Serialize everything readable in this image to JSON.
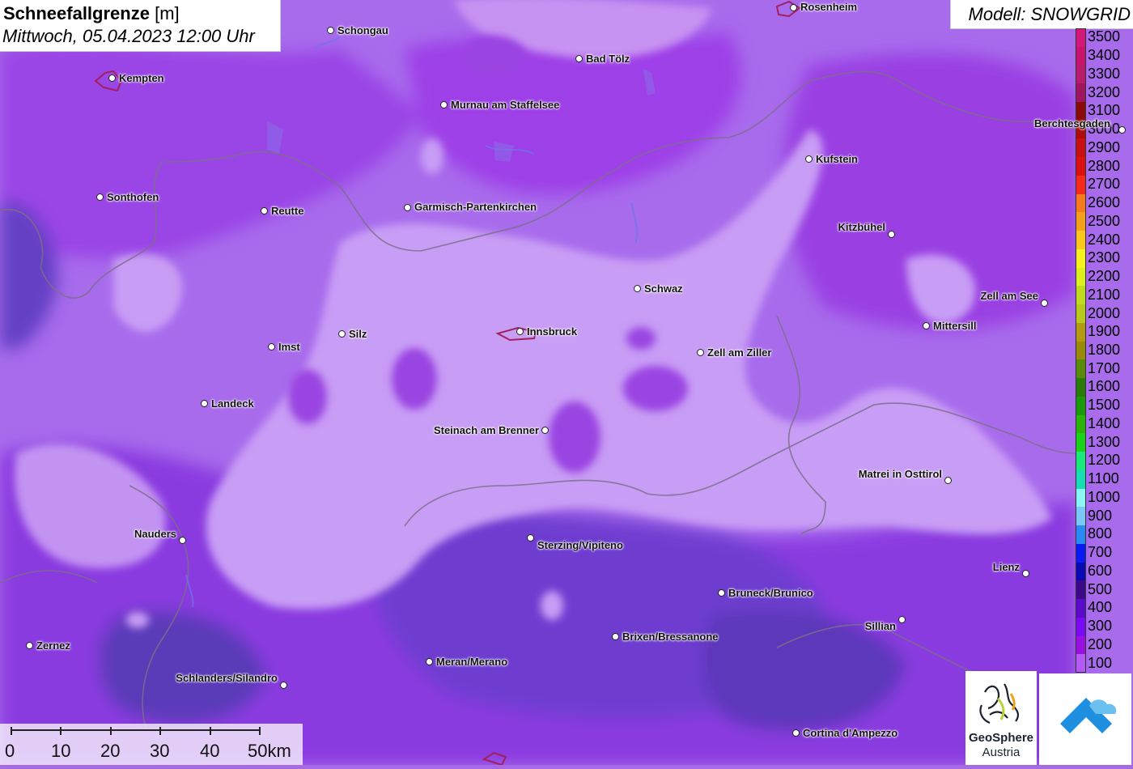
{
  "header": {
    "title": "Schneefallgrenze",
    "unit": "[m]",
    "datetime": "Mittwoch, 05.04.2023 12:00 Uhr"
  },
  "model_label": "Modell: SNOWGRID",
  "legend": {
    "labels": [
      "3500",
      "3400",
      "3300",
      "3200",
      "3100",
      "3000",
      "2900",
      "2800",
      "2700",
      "2600",
      "2500",
      "2400",
      "2300",
      "2200",
      "2100",
      "2000",
      "1900",
      "1800",
      "1700",
      "1600",
      "1500",
      "1400",
      "1300",
      "1200",
      "1100",
      "1000",
      "900",
      "800",
      "700",
      "600",
      "500",
      "400",
      "300",
      "200",
      "100"
    ],
    "colors": [
      "#d4187a",
      "#c8146c",
      "#b81a6e",
      "#a01560",
      "#8a0a0a",
      "#b00a0a",
      "#c81010",
      "#dd1010",
      "#f52a1a",
      "#f57a20",
      "#f5a01a",
      "#fac81e",
      "#f5f21e",
      "#dcf01e",
      "#c0dc1e",
      "#b8c81c",
      "#b49a12",
      "#9a8a0a",
      "#5a8a0a",
      "#2a7a0a",
      "#1a9a0a",
      "#2ab40a",
      "#1ad21a",
      "#1ae87a",
      "#1adcb4",
      "#8af5f5",
      "#7ac8f5",
      "#2a8af5",
      "#0a1af5",
      "#0a0ab4",
      "#3a0a8a",
      "#5a0ac8",
      "#7a0af5",
      "#9a10e0",
      "#b45af5"
    ]
  },
  "cities": [
    {
      "name": "Rosenheim",
      "dot": [
        980,
        9
      ],
      "label": [
        989,
        9
      ],
      "align": "left"
    },
    {
      "name": "Schongau",
      "dot": [
        408,
        37
      ],
      "label": [
        417,
        38
      ],
      "align": "left"
    },
    {
      "name": "Bad Tölz",
      "dot": [
        715,
        72
      ],
      "label": [
        724,
        73
      ],
      "align": "left"
    },
    {
      "name": "Kempten",
      "dot": [
        138,
        96
      ],
      "label": [
        147,
        97
      ],
      "align": "left"
    },
    {
      "name": "Murnau am Staffelsee",
      "dot": [
        548,
        129
      ],
      "label": [
        557,
        130
      ],
      "align": "left"
    },
    {
      "name": "Berchtesgaden",
      "dot": [
        1386,
        160
      ],
      "label": [
        1278,
        153
      ],
      "align": "left"
    },
    {
      "name": "Kufstein",
      "dot": [
        999,
        196
      ],
      "label": [
        1008,
        197
      ],
      "align": "left"
    },
    {
      "name": "Sonthofen",
      "dot": [
        123,
        243
      ],
      "label": [
        132,
        244
      ],
      "align": "left"
    },
    {
      "name": "Reutte",
      "dot": [
        326,
        260
      ],
      "label": [
        335,
        261
      ],
      "align": "left"
    },
    {
      "name": "Garmisch-Partenkirchen",
      "dot": [
        503,
        256
      ],
      "label": [
        512,
        256
      ],
      "align": "left"
    },
    {
      "name": "Kitzbühel",
      "dot": [
        1101,
        289
      ],
      "label": [
        1094,
        281
      ],
      "align": "right"
    },
    {
      "name": "Schwaz",
      "dot": [
        787,
        356
      ],
      "label": [
        796,
        357
      ],
      "align": "left"
    },
    {
      "name": "Zell am See",
      "dot": [
        1290,
        374
      ],
      "label": [
        1283,
        366
      ],
      "align": "right"
    },
    {
      "name": "Mittersill",
      "dot": [
        1144,
        402
      ],
      "label": [
        1153,
        403
      ],
      "align": "left"
    },
    {
      "name": "Innsbruck",
      "dot": [
        642,
        409
      ],
      "label": [
        651,
        410
      ],
      "align": "left"
    },
    {
      "name": "Silz",
      "dot": [
        422,
        412
      ],
      "label": [
        431,
        413
      ],
      "align": "left"
    },
    {
      "name": "Imst",
      "dot": [
        335,
        428
      ],
      "label": [
        344,
        429
      ],
      "align": "left"
    },
    {
      "name": "Zell am Ziller",
      "dot": [
        865,
        435
      ],
      "label": [
        874,
        436
      ],
      "align": "left"
    },
    {
      "name": "Landeck",
      "dot": [
        252,
        498
      ],
      "label": [
        261,
        499
      ],
      "align": "left"
    },
    {
      "name": "Steinach am Brenner",
      "dot": [
        673,
        531
      ],
      "label": [
        666,
        532
      ],
      "align": "right"
    },
    {
      "name": "Matrei in Osttirol",
      "dot": [
        1171,
        593
      ],
      "label": [
        1164,
        586
      ],
      "align": "right"
    },
    {
      "name": "Nauders",
      "dot": [
        225,
        667
      ],
      "label": [
        218,
        660
      ],
      "align": "right"
    },
    {
      "name": "Sterzing/Vipiteno",
      "dot": [
        655,
        664
      ],
      "label": [
        664,
        674
      ],
      "align": "left"
    },
    {
      "name": "Lienz",
      "dot": [
        1267,
        708
      ],
      "label": [
        1260,
        701
      ],
      "align": "right"
    },
    {
      "name": "Bruneck/Brunico",
      "dot": [
        891,
        732
      ],
      "label": [
        900,
        733
      ],
      "align": "left"
    },
    {
      "name": "Sillian",
      "dot": [
        1114,
        765
      ],
      "label": [
        1107,
        774
      ],
      "align": "right"
    },
    {
      "name": "Brixen/Bressanone",
      "dot": [
        760,
        786
      ],
      "label": [
        769,
        787
      ],
      "align": "left"
    },
    {
      "name": "Zernez",
      "dot": [
        36,
        797
      ],
      "label": [
        45,
        798
      ],
      "align": "left"
    },
    {
      "name": "Meran/Merano",
      "dot": [
        530,
        817
      ],
      "label": [
        539,
        818
      ],
      "align": "left"
    },
    {
      "name": "Schlanders/Silandro",
      "dot": [
        350,
        846
      ],
      "label": [
        343,
        838
      ],
      "align": "right"
    },
    {
      "name": "Cortina d'Ampezzo",
      "dot": [
        983,
        905
      ],
      "label": [
        992,
        906
      ],
      "align": "left"
    }
  ],
  "scale": {
    "labels": [
      "0",
      "10",
      "20",
      "30",
      "40",
      "50km"
    ]
  },
  "logos": {
    "geosphere_line1": "GeoSphere",
    "geosphere_line2": "Austria"
  }
}
